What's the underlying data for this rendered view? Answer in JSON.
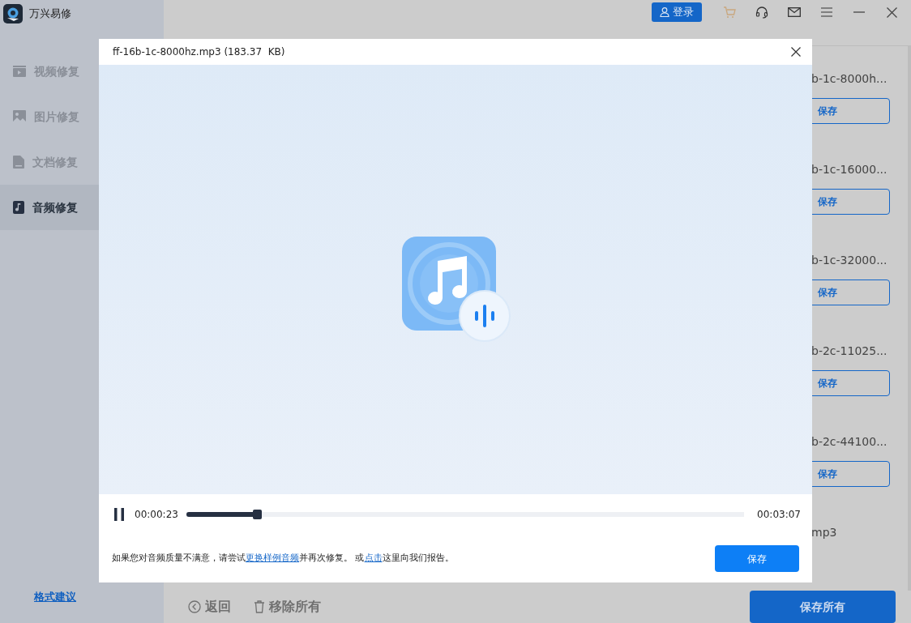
{
  "app": {
    "title": "万兴易修",
    "login": "登录"
  },
  "sidebar": {
    "items": [
      {
        "label": "视频修复",
        "kind": "video",
        "selected": false
      },
      {
        "label": "图片修复",
        "kind": "image",
        "selected": false
      },
      {
        "label": "文档修复",
        "kind": "document",
        "selected": false
      },
      {
        "label": "音频修复",
        "kind": "audio",
        "selected": true
      }
    ],
    "format_link": "格式建议"
  },
  "main": {
    "files": [
      {
        "name": "b-1c-8000h...",
        "save": "保存"
      },
      {
        "name": "b-1c-16000...",
        "save": "保存"
      },
      {
        "name": "b-1c-32000...",
        "save": "保存"
      },
      {
        "name": "b-2c-11025...",
        "save": "保存"
      },
      {
        "name": "b-2c-44100...",
        "save": "保存"
      },
      {
        "name": "mp3"
      }
    ],
    "back": "返回",
    "remove_all": "移除所有",
    "save_all": "保存所有"
  },
  "dialog": {
    "title": "ff-16b-1c-8000hz.mp3 (183.37  KB)",
    "player": {
      "playing": true,
      "elapsed": "00:00:23",
      "level": 0.128,
      "total": "00:03:07"
    },
    "notice": [
      {
        "kind": "text",
        "text": "如果您对音频质量不满意，请尝试"
      },
      {
        "kind": "link",
        "text": "更换样例音频"
      },
      {
        "kind": "text",
        "text": "并再次修复。 或"
      },
      {
        "kind": "link",
        "text": "点击"
      },
      {
        "kind": "text",
        "text": "这里向我们报告。"
      }
    ],
    "save": "保存"
  }
}
